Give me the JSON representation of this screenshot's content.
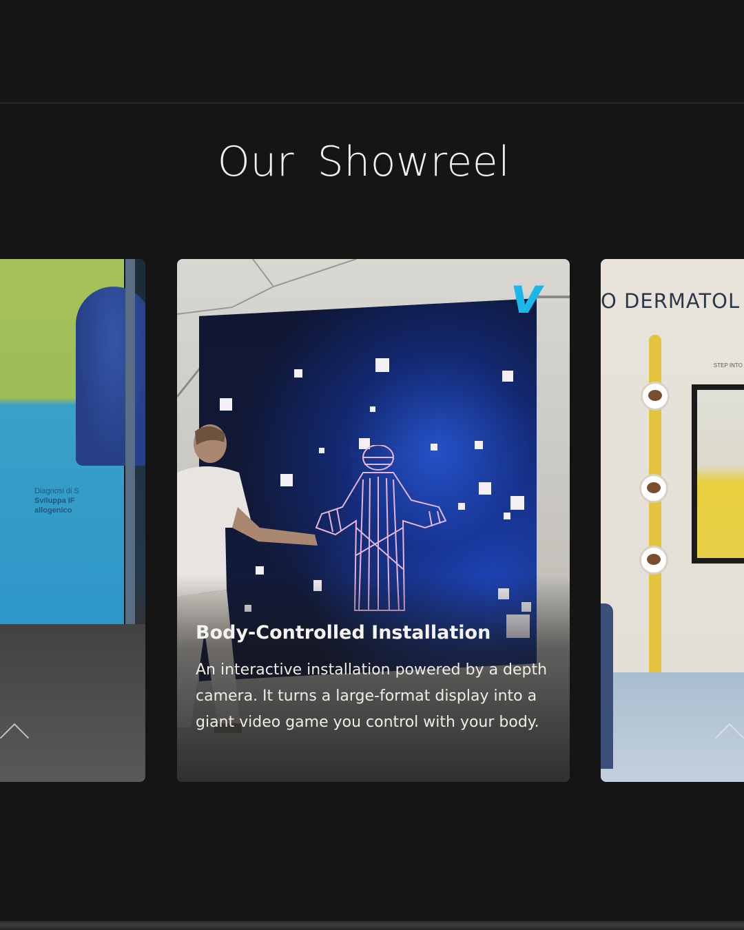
{
  "section": {
    "title": "Our  Showreel"
  },
  "cards": {
    "left": {
      "screen_text_1": "Diagnosi di S",
      "screen_text_2": "Sviluppa IF",
      "screen_text_3": "allogenico"
    },
    "center": {
      "title": "Body-Controlled Installation",
      "description": "An interactive installation powered by a depth camera. It turns a large-format display into a giant video game you control with your body.",
      "badge_icon": "vimeo-icon",
      "badge_glyph": "v"
    },
    "right": {
      "header_text": "O DERMATOL",
      "small_text": "STEP INTO THE THE LAMP"
    }
  },
  "icons": {
    "left_chevron": "chevron-up-icon",
    "right_chevron": "chevron-up-icon"
  },
  "colors": {
    "background": "#151515",
    "title": "#f2f0ec",
    "vimeo": "#1ab7ea"
  }
}
